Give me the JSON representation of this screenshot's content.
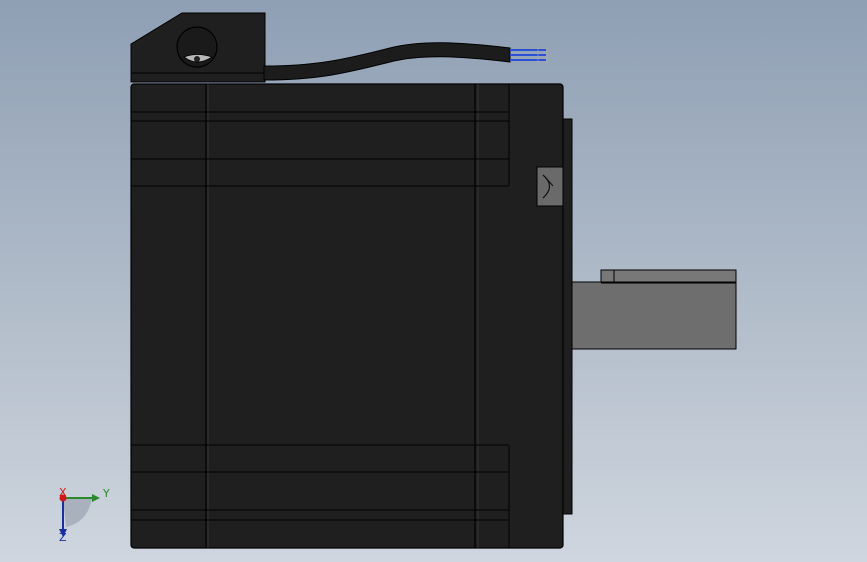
{
  "viewport": {
    "background_top": "#8f9fb4",
    "background_bottom": "#cfd6df"
  },
  "model": {
    "body_color": "#1f1f1f",
    "edge_color": "#000000",
    "shaft_color": "#6e6e6e",
    "wire_colors": [
      "#2a50d6",
      "#2a50d6",
      "#2a50d6"
    ]
  },
  "triad": {
    "x_label": "X",
    "y_label": "Y",
    "z_label": "Z",
    "x_color": "#d01818",
    "y_color": "#2a8a2a",
    "z_color": "#1a2fa0"
  }
}
